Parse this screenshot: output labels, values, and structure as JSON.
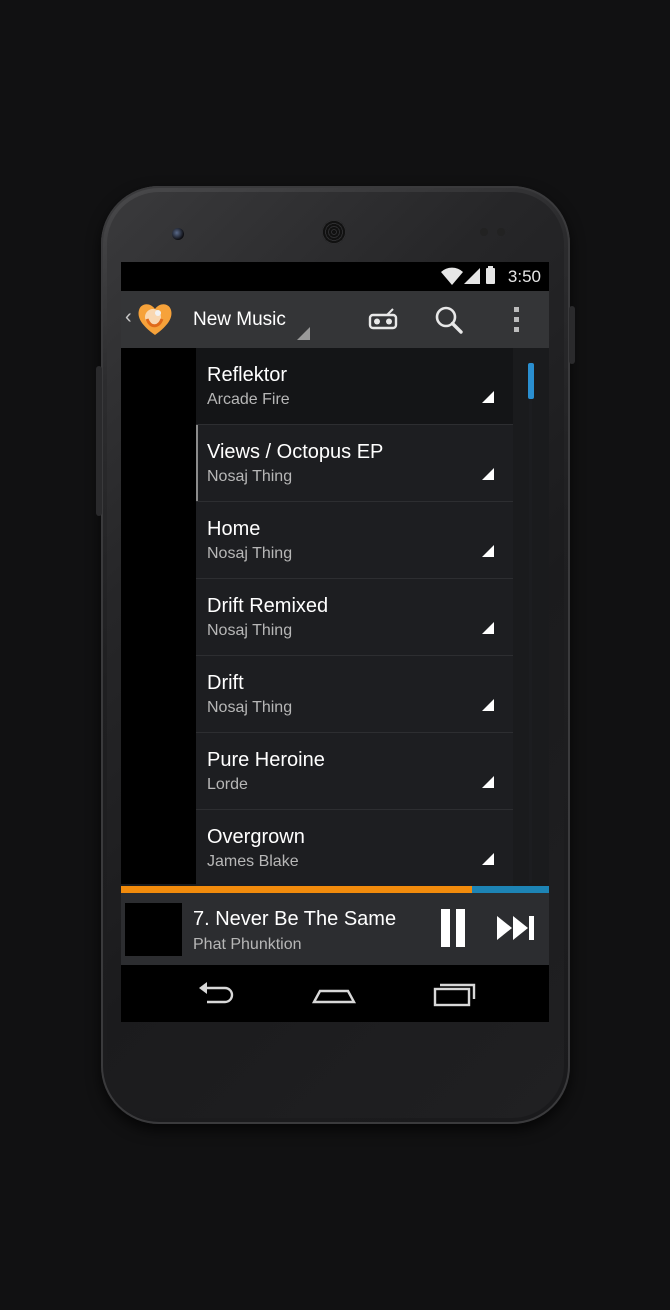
{
  "status_bar": {
    "time": "3:50",
    "icons": [
      "wifi-icon",
      "signal-icon",
      "battery-icon"
    ]
  },
  "action_bar": {
    "title": "New Music",
    "icons": [
      "back-chevron-icon",
      "app-logo-heart",
      "radio-icon",
      "search-icon",
      "overflow-menu-icon"
    ]
  },
  "albums": [
    {
      "title": "Reflektor",
      "artist": "Arcade Fire"
    },
    {
      "title": "Views / Octopus EP",
      "artist": "Nosaj Thing"
    },
    {
      "title": "Home",
      "artist": "Nosaj Thing"
    },
    {
      "title": "Drift Remixed",
      "artist": "Nosaj Thing"
    },
    {
      "title": "Drift",
      "artist": "Nosaj Thing"
    },
    {
      "title": "Pure Heroine",
      "artist": "Lorde"
    },
    {
      "title": "Overgrown",
      "artist": "James Blake"
    }
  ],
  "playback": {
    "progress_fraction": 0.82,
    "track": "7. Never Be The Same",
    "artist": "Phat Phunktion",
    "controls": [
      "pause-icon",
      "skip-next-icon"
    ]
  },
  "navigation_bar": {
    "buttons": [
      "back-icon",
      "home-icon",
      "recent-apps-icon"
    ]
  },
  "colors": {
    "accent_orange": "#f28b0c",
    "accent_blue": "#1d84b5",
    "scroll_thumb": "#2a8fd0",
    "action_bar_bg": "#343537"
  }
}
